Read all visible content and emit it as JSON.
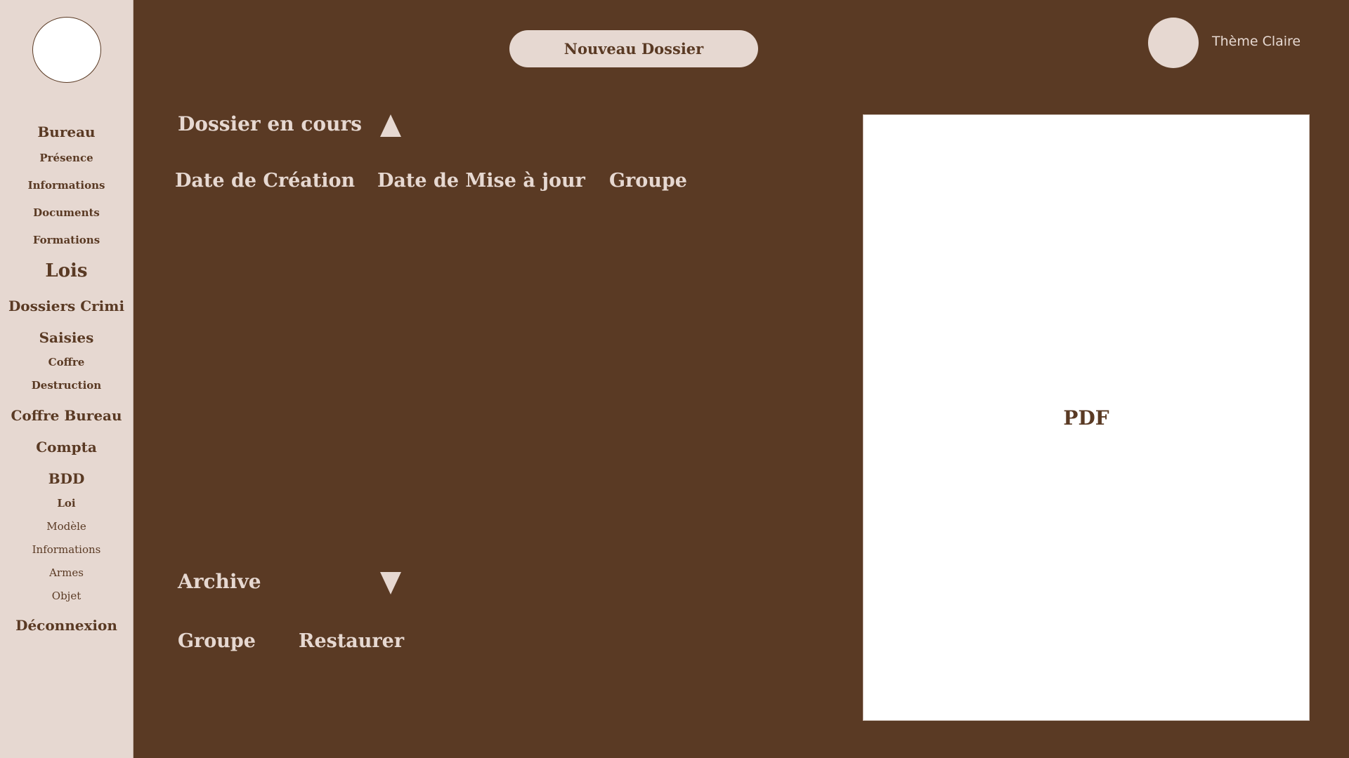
{
  "sidebar": {
    "items": [
      {
        "label": "Bureau"
      },
      {
        "label": "Présence"
      },
      {
        "label": "Informations"
      },
      {
        "label": "Documents"
      },
      {
        "label": "Formations"
      },
      {
        "label": "Lois"
      },
      {
        "label": "Dossiers Crimi"
      },
      {
        "label": "Saisies"
      },
      {
        "label": "Coffre"
      },
      {
        "label": "Destruction"
      },
      {
        "label": "Coffre Bureau"
      },
      {
        "label": "Compta"
      },
      {
        "label": "BDD"
      },
      {
        "label": "Loi"
      },
      {
        "label": "Modèle"
      },
      {
        "label": "Informations"
      },
      {
        "label": "Armes"
      },
      {
        "label": "Objet"
      },
      {
        "label": "Déconnexion"
      }
    ]
  },
  "header": {
    "new_folder_label": "Nouveau Dossier",
    "theme_label": "Thème Claire"
  },
  "current": {
    "title": "Dossier en cours",
    "columns": [
      "Date de Création",
      "Date de Mise à jour",
      "Groupe"
    ]
  },
  "archive": {
    "title": "Archive",
    "columns": [
      "Groupe",
      "Restaurer"
    ]
  },
  "preview": {
    "label": "PDF"
  },
  "colors": {
    "background": "#5a3a24",
    "sidebar": "#e6d8d1",
    "accent_text": "#e6d8d1",
    "panel": "#ffffff"
  }
}
